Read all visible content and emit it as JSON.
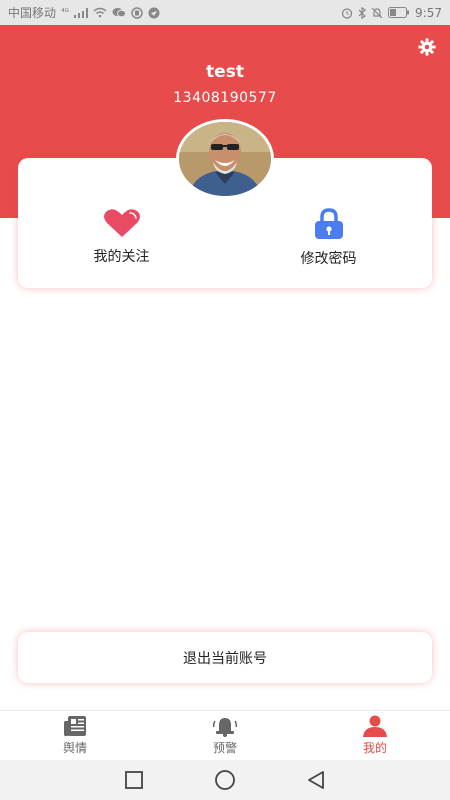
{
  "status_bar": {
    "carrier": "中国移动",
    "signal_label": "⁴ᴳ",
    "time": "9:57"
  },
  "profile": {
    "username": "test",
    "phone": "13408190577"
  },
  "actions": [
    {
      "label": "我的关注",
      "icon": "heart-icon",
      "color": "#e84b63"
    },
    {
      "label": "修改密码",
      "icon": "lock-icon",
      "color": "#4a7ef0"
    }
  ],
  "logout_label": "退出当前账号",
  "tabs": [
    {
      "label": "舆情",
      "icon": "newspaper-icon",
      "active": false
    },
    {
      "label": "预警",
      "icon": "bell-icon",
      "active": false
    },
    {
      "label": "我的",
      "icon": "person-icon",
      "active": true
    }
  ],
  "colors": {
    "accent": "#e84b4b",
    "heart": "#e84b63",
    "lock": "#4a7ef0"
  }
}
